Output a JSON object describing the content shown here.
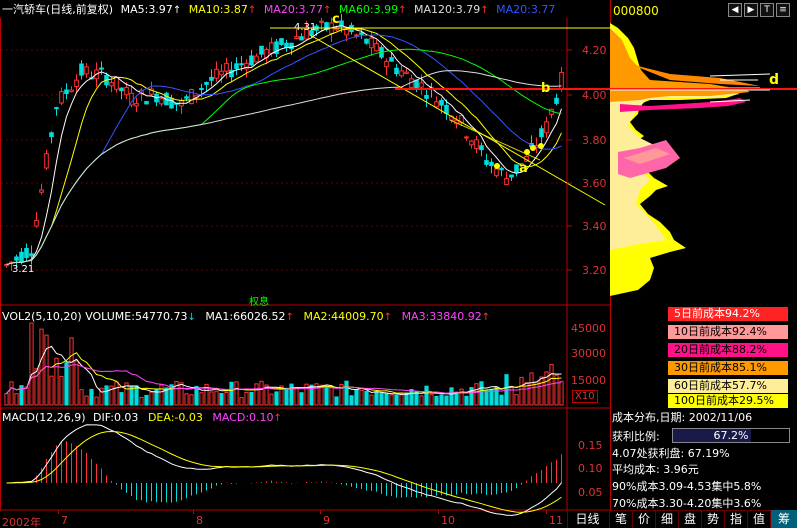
{
  "main_header": {
    "title": "一汽轿车(日线,前复权)",
    "ma5": "MA5:3.97",
    "ma10": "MA10:3.87",
    "ma20": "MA20:3.77",
    "ma60": "MA60:3.99",
    "ma120": "MA120:3.79",
    "ma20b": "MA20:3.77",
    "arrow": "↑"
  },
  "colors": {
    "ma5": "#ffffff",
    "ma10": "#ffff00",
    "ma20": "#ff44ff",
    "ma60": "#00ff00",
    "ma120": "#dddddd",
    "ma20b": "#3355ff",
    "up": "#ff3333",
    "down": "#00dddd",
    "axis": "#b00000",
    "annotation": "#ffff00",
    "vol_ma3": "#ff44ff"
  },
  "annotations": {
    "a": "a",
    "b": "b",
    "c": "c",
    "d": "d",
    "high_label": "4.31",
    "low_label": "3.21",
    "event_label": "权息"
  },
  "price_axis": {
    "ticks": [
      "4.20",
      "4.00",
      "3.80",
      "3.60",
      "3.40",
      "3.20"
    ]
  },
  "volume_header": {
    "vol": "VOL2(5,10,20)",
    "volume": "VOLUME:54770.73",
    "down_arrow": "↓",
    "ma1": "MA1:66026.52",
    "ma2": "MA2:44009.70",
    "ma3": "MA3:33840.92",
    "arrow": "↑"
  },
  "volume_axis": {
    "ticks": [
      "45000",
      "30000",
      "15000"
    ],
    "unit": "X10"
  },
  "macd_header": {
    "macd": "MACD(12,26,9)",
    "dif": "DIF:0.03",
    "dea": "DEA:-0.03",
    "macd_val": "MACD:0.10",
    "arrow": "↑"
  },
  "macd_axis": {
    "ticks": [
      "0.15",
      "0.10",
      "0.05"
    ]
  },
  "time_axis": {
    "labels": [
      "2002年",
      "7",
      "8",
      "9",
      "10",
      "11"
    ]
  },
  "cost_panel": {
    "code": "000800",
    "rows": [
      {
        "label": "5日前成本94.2%",
        "bg": "#ff2222",
        "fg": "#ffffff"
      },
      {
        "label": "10日前成本92.4%",
        "bg": "#ff9999",
        "fg": "#000000"
      },
      {
        "label": "20日前成本88.2%",
        "bg": "#ff1188",
        "fg": "#000000"
      },
      {
        "label": "30日前成本85.1%",
        "bg": "#ff9900",
        "fg": "#000000"
      },
      {
        "label": "60日前成本57.7%",
        "bg": "#ffee99",
        "fg": "#000000"
      },
      {
        "label": "100日前成本29.5%",
        "bg": "#ffff00",
        "fg": "#000000"
      }
    ],
    "dist_title": "成本分布,日期: 2002/11/06",
    "profit_label": "获利比例:",
    "profit_value": "67.2%",
    "profit_line": "4.07处获利盘: 67.19%",
    "avg_cost": "平均成本: 3.96元",
    "line90": "90%成本3.09-4.53集中5.8%",
    "line70": "70%成本3.30-4.20集中3.6%"
  },
  "bottom_tabs": {
    "period": "日线",
    "items": [
      "笔",
      "价",
      "细",
      "盘",
      "势",
      "指",
      "值",
      "筹"
    ]
  },
  "toolbar_icons": [
    "◀",
    "▶",
    "T",
    "≡"
  ]
}
